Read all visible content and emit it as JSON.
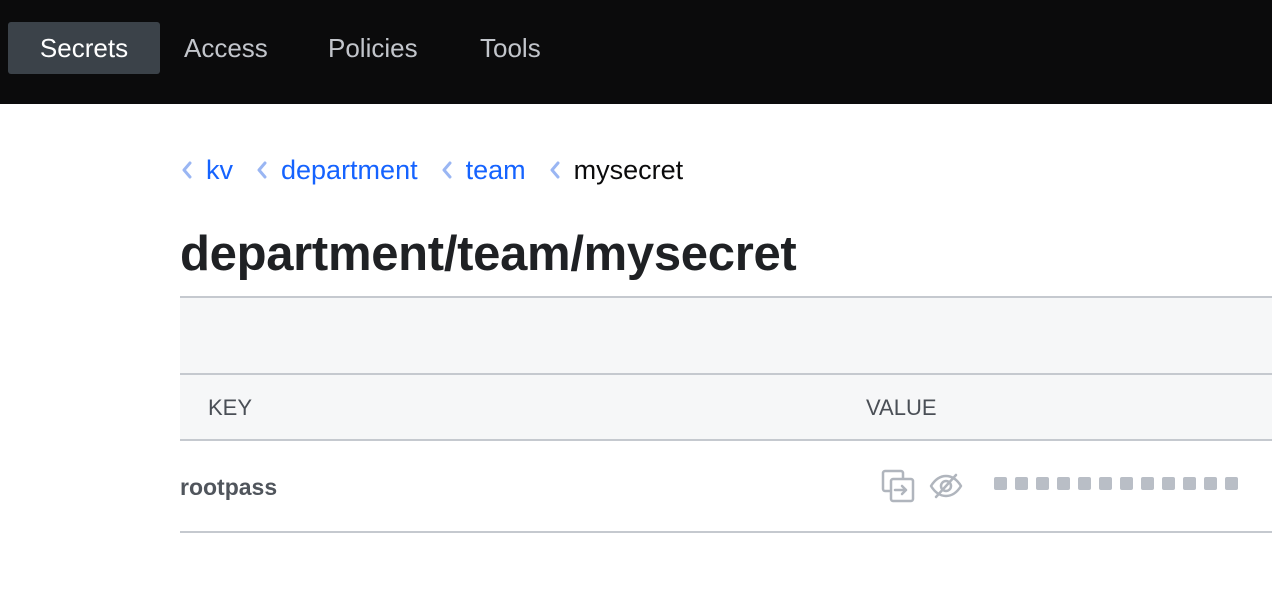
{
  "nav": {
    "items": [
      {
        "label": "Secrets",
        "active": true
      },
      {
        "label": "Access",
        "active": false
      },
      {
        "label": "Policies",
        "active": false
      },
      {
        "label": "Tools",
        "active": false
      }
    ]
  },
  "breadcrumb": {
    "items": [
      {
        "label": "kv",
        "link": true
      },
      {
        "label": "department",
        "link": true
      },
      {
        "label": "team",
        "link": true
      },
      {
        "label": "mysecret",
        "link": false
      }
    ]
  },
  "page": {
    "title": "department/team/mysecret"
  },
  "table": {
    "columns": [
      "KEY",
      "VALUE"
    ],
    "rows": [
      {
        "key": "rootpass",
        "value_masked": true,
        "mask_dots": 12
      }
    ]
  },
  "icons": {
    "chevron": "chevron-left-icon",
    "copy": "copy-icon",
    "reveal": "eye-slash-icon"
  },
  "colors": {
    "nav_bg": "#0b0b0c",
    "nav_active_bg": "#3b4249",
    "link": "#1563ff",
    "border": "#c5c9cf",
    "header_bg": "#f6f7f8"
  }
}
